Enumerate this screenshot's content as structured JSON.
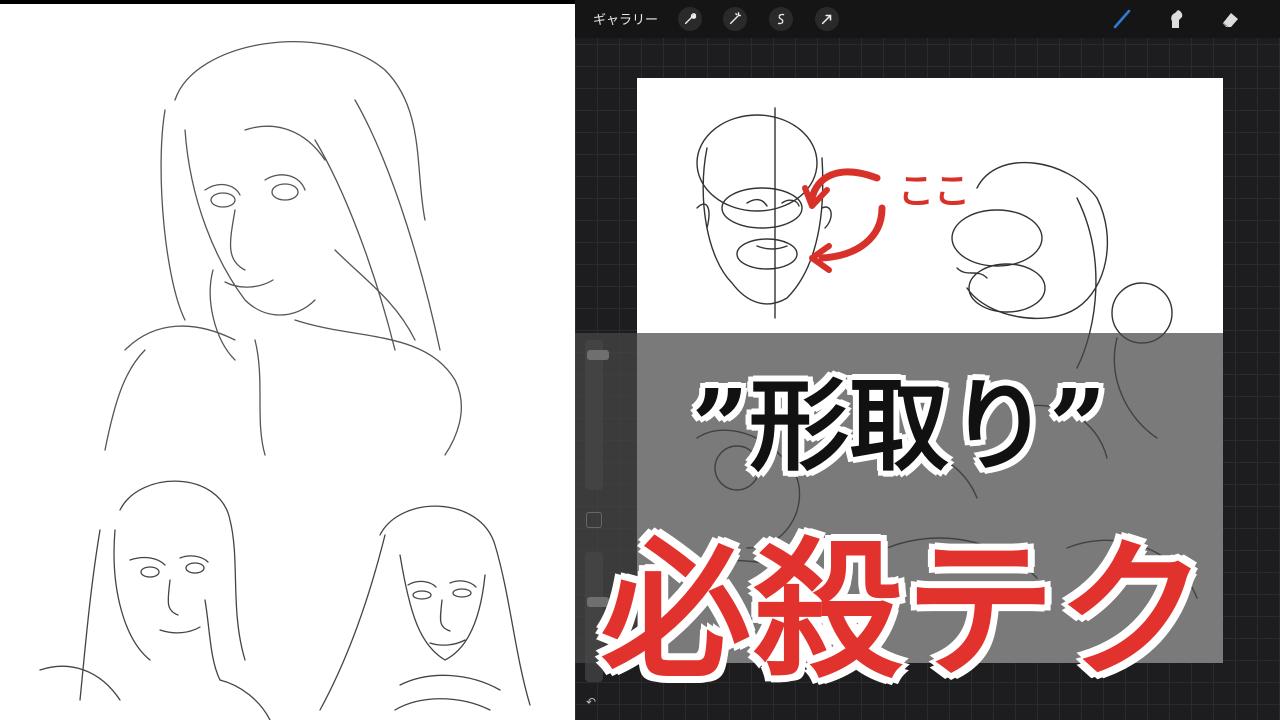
{
  "toolbar": {
    "gallery_label": "ギャラリー",
    "left_tools": [
      "wrench-icon",
      "magic-wand-icon",
      "selection-icon",
      "transform-arrow-icon"
    ],
    "right_tools": [
      "brush-icon",
      "smudge-icon",
      "eraser-icon"
    ],
    "accent_color": "#2f7bd8"
  },
  "canvas": {
    "annotation_label": "ここ",
    "annotation_color": "#d8312a"
  },
  "headline": {
    "line1": "”形取り”",
    "line2": "必殺テク",
    "line2_color": "#e2322d"
  }
}
